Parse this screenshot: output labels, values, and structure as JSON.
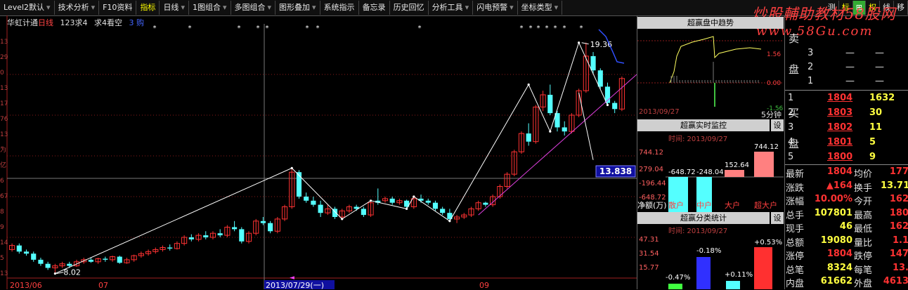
{
  "toolbar": {
    "items": [
      "Level2默认",
      "技术分析",
      "F10资料",
      "指标",
      "日线",
      "1图组合",
      "多图组合",
      "图形叠加",
      "系统指示",
      "备忘录",
      "历史回忆",
      "分析工具",
      "闪电预警",
      "坐标类型"
    ],
    "right_items": [
      "测",
      "标",
      "⊞",
      "权",
      "线",
      "移"
    ]
  },
  "watermark": {
    "line1": "炒股輔助教材58股网",
    "line2": "www.58Gu.com"
  },
  "chart_header": {
    "stock_name": "华虹计通",
    "period": "日线",
    "item1": "123求4",
    "item2": "求4看空",
    "item3": "3    购"
  },
  "chart": {
    "max_label": "19.36",
    "min_label": "8.02",
    "price_tag": "13.838",
    "x_labels": [
      "2013/06",
      "07",
      "2013/07/29(一)",
      "09"
    ],
    "left_axis": [
      "13",
      "29",
      "0",
      "13",
      "17",
      "76",
      "13",
      "为",
      "亿",
      "6",
      "67",
      "8",
      "9",
      "14",
      "5",
      "13"
    ]
  },
  "chart_data": {
    "type": "candlestick",
    "candles": [
      [
        9.2,
        9.5,
        9.1,
        9.4,
        0
      ],
      [
        9.4,
        9.5,
        9.0,
        9.1,
        1
      ],
      [
        9.1,
        9.2,
        8.9,
        9.0,
        1
      ],
      [
        9.0,
        9.1,
        8.6,
        8.7,
        1
      ],
      [
        8.7,
        8.8,
        8.4,
        8.5,
        1
      ],
      [
        8.5,
        8.6,
        8.2,
        8.3,
        1
      ],
      [
        8.3,
        8.5,
        8.02,
        8.4,
        0
      ],
      [
        8.4,
        8.6,
        8.3,
        8.5,
        0
      ],
      [
        8.5,
        8.6,
        8.3,
        8.4,
        1
      ],
      [
        8.4,
        8.7,
        8.35,
        8.6,
        0
      ],
      [
        8.6,
        8.8,
        8.5,
        8.7,
        0
      ],
      [
        8.7,
        8.8,
        8.55,
        8.6,
        1
      ],
      [
        8.6,
        8.8,
        8.5,
        8.75,
        0
      ],
      [
        8.75,
        8.85,
        8.6,
        8.7,
        1
      ],
      [
        8.7,
        8.9,
        8.6,
        8.85,
        0
      ],
      [
        8.85,
        8.9,
        8.5,
        8.55,
        1
      ],
      [
        8.55,
        8.8,
        8.5,
        8.7,
        0
      ],
      [
        8.7,
        8.95,
        8.6,
        8.9,
        0
      ],
      [
        8.9,
        9.1,
        8.8,
        9.0,
        0
      ],
      [
        9.0,
        9.2,
        8.9,
        9.1,
        0
      ],
      [
        9.1,
        9.3,
        9.0,
        9.2,
        0
      ],
      [
        9.2,
        9.4,
        9.1,
        9.3,
        0
      ],
      [
        9.3,
        9.45,
        9.15,
        9.25,
        1
      ],
      [
        9.25,
        9.6,
        9.2,
        9.5,
        0
      ],
      [
        9.5,
        9.9,
        9.4,
        9.8,
        0
      ],
      [
        9.8,
        9.95,
        9.6,
        9.7,
        1
      ],
      [
        9.7,
        10.0,
        9.6,
        9.9,
        0
      ],
      [
        9.9,
        10.1,
        9.7,
        9.8,
        1
      ],
      [
        9.8,
        10.1,
        9.7,
        10.0,
        0
      ],
      [
        10.0,
        10.2,
        9.8,
        9.9,
        1
      ],
      [
        9.9,
        10.4,
        9.8,
        10.3,
        0
      ],
      [
        10.3,
        10.6,
        10.1,
        10.2,
        1
      ],
      [
        10.2,
        10.3,
        9.5,
        9.6,
        1
      ],
      [
        9.6,
        10.1,
        9.5,
        10.0,
        0
      ],
      [
        10.0,
        10.7,
        9.9,
        10.6,
        0
      ],
      [
        10.6,
        10.8,
        10.4,
        10.5,
        1
      ],
      [
        10.5,
        10.6,
        10.0,
        10.1,
        1
      ],
      [
        10.1,
        10.8,
        10.0,
        10.7,
        0
      ],
      [
        10.7,
        11.4,
        10.6,
        11.3,
        0
      ],
      [
        11.3,
        13.2,
        11.2,
        13.0,
        0
      ],
      [
        13.0,
        13.1,
        11.7,
        11.8,
        1
      ],
      [
        11.8,
        12.0,
        11.5,
        11.6,
        1
      ],
      [
        11.6,
        11.8,
        11.3,
        11.4,
        1
      ],
      [
        11.4,
        11.6,
        10.8,
        11.0,
        1
      ],
      [
        11.0,
        11.4,
        10.9,
        11.2,
        0
      ],
      [
        11.2,
        11.3,
        10.7,
        10.8,
        1
      ],
      [
        10.8,
        11.2,
        10.7,
        11.1,
        0
      ],
      [
        11.1,
        11.4,
        11.0,
        11.3,
        0
      ],
      [
        11.3,
        11.4,
        11.1,
        11.2,
        1
      ],
      [
        11.2,
        11.3,
        10.8,
        10.9,
        1
      ],
      [
        10.9,
        11.6,
        10.8,
        11.5,
        0
      ],
      [
        11.5,
        12.2,
        11.4,
        11.6,
        1
      ],
      [
        11.6,
        11.8,
        11.5,
        11.7,
        0
      ],
      [
        11.7,
        11.8,
        11.4,
        11.5,
        1
      ],
      [
        11.5,
        11.7,
        11.4,
        11.6,
        0
      ],
      [
        11.6,
        11.65,
        11.2,
        11.3,
        1
      ],
      [
        11.3,
        11.8,
        11.2,
        11.7,
        0
      ],
      [
        11.7,
        11.9,
        11.5,
        11.6,
        1
      ],
      [
        11.6,
        11.7,
        11.4,
        11.5,
        1
      ],
      [
        11.5,
        11.6,
        11.1,
        11.2,
        1
      ],
      [
        11.2,
        11.3,
        10.9,
        11.0,
        1
      ],
      [
        11.0,
        11.2,
        10.6,
        10.7,
        1
      ],
      [
        10.7,
        10.9,
        10.5,
        10.8,
        0
      ],
      [
        10.8,
        11.0,
        10.7,
        10.9,
        0
      ],
      [
        10.9,
        11.3,
        10.8,
        11.2,
        0
      ],
      [
        11.2,
        11.6,
        11.1,
        11.5,
        0
      ],
      [
        11.5,
        11.55,
        11.3,
        11.4,
        1
      ],
      [
        11.4,
        11.9,
        11.3,
        11.8,
        0
      ],
      [
        11.8,
        12.4,
        11.7,
        12.3,
        0
      ],
      [
        12.3,
        13.0,
        12.2,
        12.9,
        0
      ],
      [
        12.9,
        14.1,
        12.8,
        14.0,
        0
      ],
      [
        14.0,
        15.0,
        13.9,
        14.9,
        0
      ],
      [
        14.9,
        15.4,
        14.3,
        14.5,
        1
      ],
      [
        14.5,
        16.3,
        14.4,
        16.2,
        0
      ],
      [
        16.2,
        17.0,
        16.0,
        16.8,
        0
      ],
      [
        16.8,
        17.3,
        15.8,
        15.9,
        1
      ],
      [
        15.9,
        16.0,
        15.0,
        15.2,
        1
      ],
      [
        15.2,
        15.5,
        14.8,
        15.0,
        1
      ],
      [
        15.0,
        15.9,
        14.9,
        15.8,
        0
      ],
      [
        15.8,
        17.1,
        15.7,
        17.0,
        0
      ],
      [
        17.0,
        19.36,
        16.9,
        18.7,
        0
      ],
      [
        18.7,
        18.9,
        17.8,
        18.0,
        1
      ],
      [
        18.0,
        18.1,
        17.1,
        17.2,
        1
      ],
      [
        17.2,
        17.4,
        16.3,
        16.4,
        1
      ],
      [
        16.4,
        16.5,
        15.9,
        16.1,
        1
      ],
      [
        16.1,
        17.7,
        16.0,
        17.6,
        0
      ]
    ]
  },
  "mid_panels": {
    "trend": {
      "title": "超赢盘中趋势",
      "price_labels": [
        "1.56",
        "0.00",
        "-1.56"
      ],
      "date": "2013/09/27",
      "freq": "5分钟"
    },
    "monitor": {
      "title": "超赢实时监控",
      "btn": "设",
      "time": "时间: 2013/09/27",
      "y_labels": [
        "744.12",
        "279.04",
        "-196.44",
        "-648.72"
      ],
      "bar_labels": [
        "-648.72",
        "-248.04",
        "152.64",
        "744.12"
      ],
      "bottom_labels": [
        "净额(万)",
        "散户",
        "中户",
        "大户",
        "超大户"
      ]
    },
    "category": {
      "title": "超赢分类统计",
      "btn": "设",
      "time": "时间: 2013/09/27",
      "y_labels": [
        "47.31",
        "31.54",
        "15.77"
      ],
      "bar_labels": [
        "-0.47%",
        "-0.18%",
        "+0.11%",
        "+0.53%"
      ]
    }
  },
  "quote": {
    "sell": [
      {
        "level": "3",
        "price": "—",
        "vol": "—"
      },
      {
        "level": "2",
        "price": "—",
        "vol": "—"
      },
      {
        "level": "1",
        "price": "—",
        "vol": "—"
      }
    ],
    "sell_label": [
      "卖",
      "盘"
    ],
    "buy": [
      {
        "level": "1",
        "price": "1804",
        "vol": "1632"
      },
      {
        "level": "2",
        "price": "1803",
        "vol": "30"
      },
      {
        "level": "3",
        "price": "1802",
        "vol": "11"
      },
      {
        "level": "4",
        "price": "1801",
        "vol": "5"
      },
      {
        "level": "5",
        "price": "1800",
        "vol": "9"
      }
    ],
    "buy_label": [
      "买",
      "盘"
    ],
    "stats": [
      {
        "k1": "最新",
        "v1": "1804",
        "k2": "均价",
        "v2": "177"
      },
      {
        "k1": "涨跌",
        "v1": "▲164",
        "k2": "换手",
        "v2": "13.71%"
      },
      {
        "k1": "涨幅",
        "v1": "10.00%",
        "k2": "今开",
        "v2": "162"
      },
      {
        "k1": "总手",
        "v1": "107801",
        "k2": "最高",
        "v2": "180"
      },
      {
        "k1": "现手",
        "v1": "46",
        "k2": "最低",
        "v2": "162"
      },
      {
        "k1": "总额",
        "v1": "19080",
        "k2": "量比",
        "v2": "1.1"
      },
      {
        "k1": "涨停",
        "v1": "1804",
        "k2": "跌停",
        "v2": "147"
      },
      {
        "k1": "总笔",
        "v1": "8324",
        "k2": "每笔",
        "v2": "13."
      },
      {
        "k1": "内盘",
        "v1": "61662",
        "k2": "外盘",
        "v2": "4613"
      }
    ]
  },
  "colors": {
    "up": "#ff3232",
    "down": "#54ffff",
    "grid": "#8a1a1a",
    "accent": "#ffff00"
  }
}
